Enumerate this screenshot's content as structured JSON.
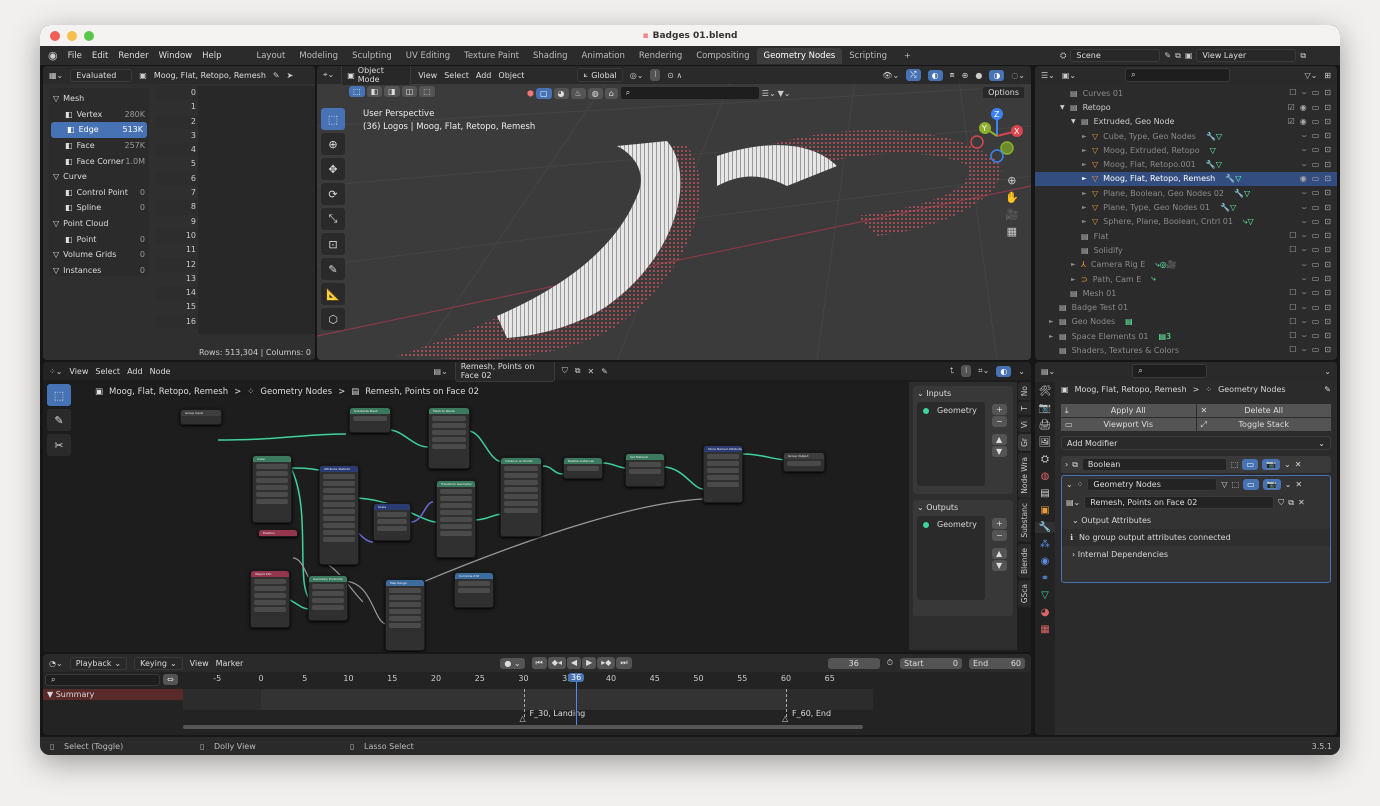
{
  "window": {
    "title": "Badges 01.blend"
  },
  "menubar": {
    "items": [
      "File",
      "Edit",
      "Render",
      "Window",
      "Help"
    ],
    "workspaces": [
      "Layout",
      "Modeling",
      "Sculpting",
      "UV Editing",
      "Texture Paint",
      "Shading",
      "Animation",
      "Rendering",
      "Compositing",
      "Geometry Nodes",
      "Scripting"
    ],
    "active_workspace": "Geometry Nodes",
    "add_label": "+",
    "scene": "Scene",
    "view_layer": "View Layer"
  },
  "spreadsheet": {
    "mode": "Evaluated",
    "object": "Moog, Flat, Retopo, Remesh",
    "domains": [
      {
        "label": "Mesh",
        "count": "",
        "level": 0,
        "icon": "mesh-icon"
      },
      {
        "label": "Vertex",
        "count": "280K",
        "level": 1,
        "icon": "vertex-icon"
      },
      {
        "label": "Edge",
        "count": "513K",
        "level": 1,
        "icon": "edge-icon",
        "selected": true
      },
      {
        "label": "Face",
        "count": "257K",
        "level": 1,
        "icon": "face-icon"
      },
      {
        "label": "Face Corner",
        "count": "1.0M",
        "level": 1,
        "icon": "face-corner-icon"
      },
      {
        "label": "Curve",
        "count": "",
        "level": 0,
        "icon": "curve-icon"
      },
      {
        "label": "Control Point",
        "count": "0",
        "level": 1,
        "icon": "control-point-icon"
      },
      {
        "label": "Spline",
        "count": "0",
        "level": 1,
        "icon": "spline-icon"
      },
      {
        "label": "Point Cloud",
        "count": "",
        "level": 0,
        "icon": "point-cloud-icon"
      },
      {
        "label": "Point",
        "count": "0",
        "level": 1,
        "icon": "point-icon"
      },
      {
        "label": "Volume Grids",
        "count": "0",
        "level": 0,
        "icon": "volume-icon"
      },
      {
        "label": "Instances",
        "count": "0",
        "level": 0,
        "icon": "instances-icon"
      }
    ],
    "rows": [
      "0",
      "1",
      "2",
      "3",
      "4",
      "5",
      "6",
      "7",
      "8",
      "9",
      "10",
      "11",
      "12",
      "13",
      "14",
      "15",
      "16"
    ],
    "footer": "Rows: 513,304   |   Columns: 0"
  },
  "viewport": {
    "mode": "Object Mode",
    "menus": [
      "View",
      "Select",
      "Add",
      "Object"
    ],
    "orientation": "Global",
    "options_label": "Options",
    "overlay_title": "User Perspective",
    "overlay_subtitle": "(36) Logos | Moog, Flat, Retopo, Remesh",
    "gizmo_axes": [
      "X",
      "Y",
      "Z"
    ]
  },
  "outliner": {
    "rows": [
      {
        "label": "Curves 01",
        "indent": 3,
        "kind": "collection",
        "dim": true,
        "expand": ""
      },
      {
        "label": "Retopo",
        "indent": 3,
        "kind": "collection",
        "expand": "▼",
        "checked": true
      },
      {
        "label": "Extruded, Geo Node",
        "indent": 4,
        "kind": "collection",
        "expand": "▼",
        "checked": true
      },
      {
        "label": "Cube, Type, Geo Nodes",
        "indent": 5,
        "kind": "mesh",
        "dim": true,
        "expand": "►",
        "mods": "🔧▽"
      },
      {
        "label": "Moog, Extruded, Retopo",
        "indent": 5,
        "kind": "mesh",
        "dim": true,
        "expand": "►",
        "mods": "▽"
      },
      {
        "label": "Moog, Flat, Retopo.001",
        "indent": 5,
        "kind": "mesh",
        "dim": true,
        "expand": "►",
        "mods": "🔧▽"
      },
      {
        "label": "Moog, Flat, Retopo, Remesh",
        "indent": 5,
        "kind": "mesh",
        "selected": true,
        "expand": "►",
        "mods": "🔧▽"
      },
      {
        "label": "Plane, Boolean, Geo Nodes 02",
        "indent": 5,
        "kind": "mesh",
        "dim": true,
        "expand": "►",
        "mods": "🔧▽"
      },
      {
        "label": "Plane, Type, Geo Nodes 01",
        "indent": 5,
        "kind": "mesh",
        "dim": true,
        "expand": "►",
        "mods": "🔧▽"
      },
      {
        "label": "Sphere, Plane, Boolean, Cntrl 01",
        "indent": 5,
        "kind": "mesh",
        "dim": true,
        "expand": "►",
        "mods": "⤷▽"
      },
      {
        "label": "Flat",
        "indent": 4,
        "kind": "collection",
        "dim": true,
        "expand": ""
      },
      {
        "label": "Solidify",
        "indent": 4,
        "kind": "collection",
        "dim": true,
        "expand": ""
      },
      {
        "label": "Camera Rig E",
        "indent": 4,
        "kind": "empty",
        "dim": true,
        "expand": "►",
        "mods": "⤷◎🎥"
      },
      {
        "label": "Path, Cam E",
        "indent": 4,
        "kind": "curve",
        "dim": true,
        "expand": "►",
        "mods": "⤷"
      },
      {
        "label": "Mesh 01",
        "indent": 3,
        "kind": "collection",
        "dim": true,
        "expand": ""
      },
      {
        "label": "Badge Test 01",
        "indent": 2,
        "kind": "collection",
        "dim": true,
        "expand": ""
      },
      {
        "label": "Geo Nodes",
        "indent": 2,
        "kind": "collection",
        "dim": true,
        "expand": "►",
        "mods": "▤"
      },
      {
        "label": "Space Elements 01",
        "indent": 2,
        "kind": "collection",
        "dim": true,
        "expand": "►",
        "mods": "▤3"
      },
      {
        "label": "Shaders, Textures & Colors",
        "indent": 2,
        "kind": "collection",
        "dim": true,
        "expand": ""
      }
    ]
  },
  "node_editor": {
    "menus": [
      "View",
      "Select",
      "Add",
      "Node"
    ],
    "node_group": "Remesh, Points on Face 02",
    "breadcrumb": [
      "Moog, Flat, Retopo, Remesh",
      "Geometry Nodes",
      "Remesh, Points on Face 02"
    ],
    "nodes": [
      {
        "title": "Group Input",
        "color": "gray"
      },
      {
        "title": "Subdivide Mesh",
        "color": "green"
      },
      {
        "title": "Mesh to Points",
        "color": "green"
      },
      {
        "title": "Cube",
        "color": "green"
      },
      {
        "title": "Attribute Statistic",
        "color": "blue"
      },
      {
        "title": "Scale",
        "color": "blue"
      },
      {
        "title": "Transform Geometry",
        "color": "green"
      },
      {
        "title": "Instance on Points",
        "color": "green"
      },
      {
        "title": "Realize Instances",
        "color": "green"
      },
      {
        "title": "Set Material",
        "color": "green"
      },
      {
        "title": "Store Named Attribute",
        "color": "blue"
      },
      {
        "title": "Group Output",
        "color": "gray"
      },
      {
        "title": "Position",
        "color": "red"
      },
      {
        "title": "Object Info",
        "color": "red"
      },
      {
        "title": "Geometry Proximity",
        "color": "green"
      },
      {
        "title": "Map Range",
        "color": "lblue"
      },
      {
        "title": "Combine XYZ",
        "color": "lblue"
      }
    ],
    "sidebar": {
      "inputs_title": "Inputs",
      "outputs_title": "Outputs",
      "input_socket": "Geometry",
      "output_socket": "Geometry",
      "tabs": [
        "No",
        "T",
        "Vi",
        "Gr",
        "Node Wra",
        "Substanc",
        "Blende",
        "GSca"
      ]
    }
  },
  "properties": {
    "breadcrumb_object": "Moog, Flat, Retopo, Remesh",
    "breadcrumb_modifier": "Geometry Nodes",
    "apply_all": "Apply All",
    "delete_all": "Delete All",
    "viewport_vis": "Viewport Vis",
    "toggle_stack": "Toggle Stack",
    "add_modifier": "Add Modifier",
    "modifiers": [
      {
        "name": "Boolean",
        "expanded": false
      },
      {
        "name": "Geometry Nodes",
        "expanded": true
      }
    ],
    "node_group": "Remesh, Points on Face 02",
    "output_attributes": "Output Attributes",
    "info_message": "No group output attributes connected",
    "internal_dependencies": "Internal Dependencies"
  },
  "timeline": {
    "menus": [
      "Playback",
      "Keying",
      "View",
      "Marker"
    ],
    "current_frame": "36",
    "start_label": "Start",
    "start": "0",
    "end_label": "End",
    "end": "60",
    "summary": "Summary",
    "ticks": [
      "-5",
      "0",
      "5",
      "10",
      "15",
      "20",
      "25",
      "30",
      "35",
      "40",
      "45",
      "50",
      "55",
      "60",
      "65"
    ],
    "markers": [
      {
        "frame": 30,
        "label": "F_30, Landing"
      },
      {
        "frame": 60,
        "label": "F_60, End"
      }
    ]
  },
  "statusbar": {
    "hints": [
      "Select (Toggle)",
      "Dolly View",
      "Lasso Select"
    ],
    "version": "3.5.1"
  },
  "colors": {
    "accent": "#4772b3",
    "selected_row": "#334d80",
    "socket_geometry": "#3fd29b",
    "summary": "#5a2a2a"
  }
}
